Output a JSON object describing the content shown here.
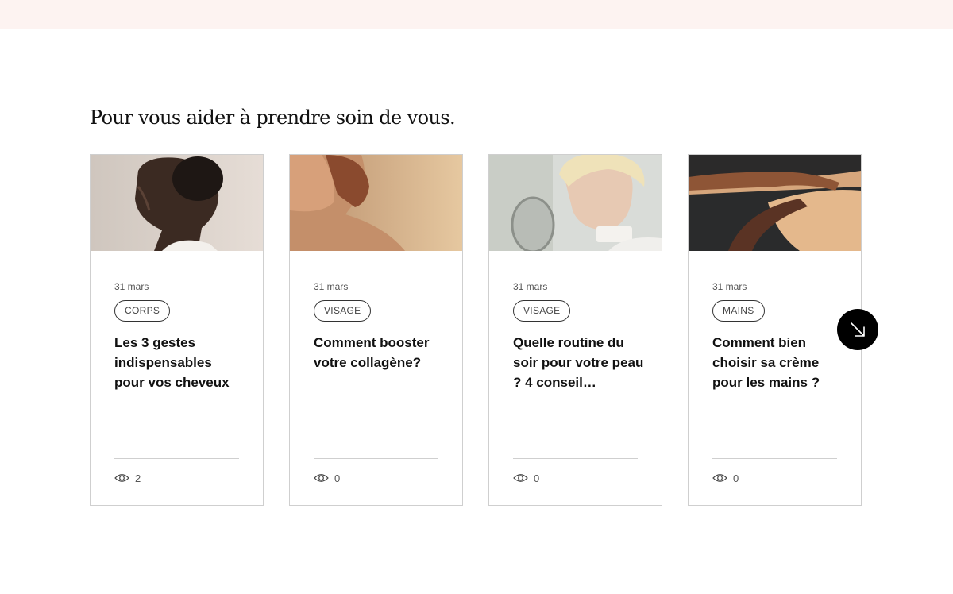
{
  "section": {
    "title": "Pour vous aider à prendre soin de vous."
  },
  "articles": [
    {
      "date": "31 mars",
      "tag": "CORPS",
      "title": "Les 3 gestes indispensables pour vos cheveux",
      "views": "2",
      "image": "portrait-woman-profile-photo"
    },
    {
      "date": "31 mars",
      "tag": "VISAGE",
      "title": "Comment booster votre collagène?",
      "views": "0",
      "image": "freckled-woman-shoulder-photo"
    },
    {
      "date": "31 mars",
      "tag": "VISAGE",
      "title": "Quelle routine du soir pour votre peau ? 4 conseil…",
      "views": "0",
      "image": "woman-mirror-skincare-photo"
    },
    {
      "date": "31 mars",
      "tag": "MAINS",
      "title": "Comment bien choisir sa crème pour les mains ?",
      "views": "0",
      "image": "hands-arms-photo"
    }
  ],
  "icons": {
    "views": "eye-icon",
    "next": "arrow-down-right-icon"
  },
  "colors": {
    "top_band": "#fdf3f1",
    "next_button": "#000000",
    "card_border": "#cfcfcf"
  }
}
